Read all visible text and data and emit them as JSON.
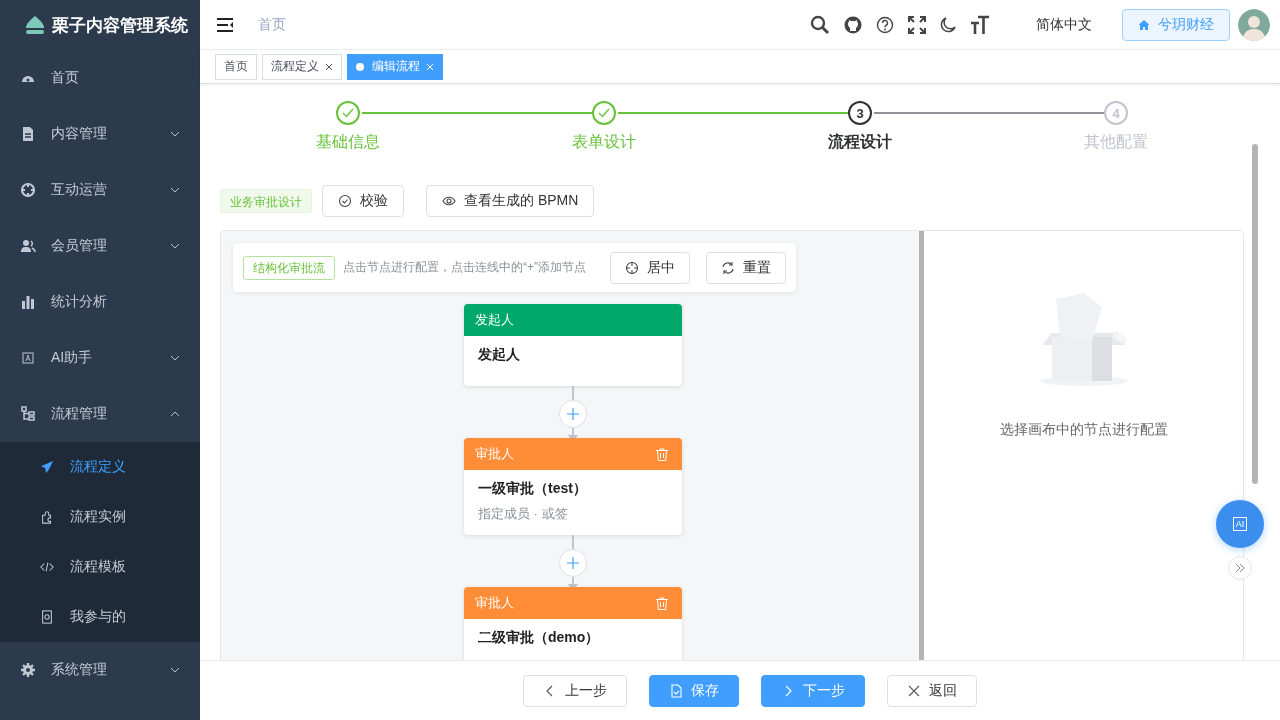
{
  "app": {
    "title": "栗子内容管理系统"
  },
  "sidebar": {
    "items": [
      {
        "label": "首页",
        "selected": false
      },
      {
        "label": "内容管理",
        "selected": false,
        "expanded": false
      },
      {
        "label": "互动运营",
        "selected": false,
        "expanded": false
      },
      {
        "label": "会员管理",
        "selected": false,
        "expanded": false
      },
      {
        "label": "统计分析",
        "selected": false
      },
      {
        "label": "AI助手",
        "selected": false,
        "expanded": false
      },
      {
        "label": "流程管理",
        "selected": false,
        "expanded": true,
        "children": [
          {
            "label": "流程定义",
            "selected": true
          },
          {
            "label": "流程实例",
            "selected": false
          },
          {
            "label": "流程模板",
            "selected": false
          },
          {
            "label": "我参与的",
            "selected": false
          }
        ]
      },
      {
        "label": "系统管理",
        "selected": false,
        "expanded": false
      }
    ]
  },
  "header": {
    "breadcrumb": [
      "首页"
    ],
    "language": "简体中文",
    "workspace_button": "兮玥财经"
  },
  "tabs": [
    {
      "label": "首页",
      "selected": false,
      "closable": false
    },
    {
      "label": "流程定义",
      "selected": false,
      "closable": true
    },
    {
      "label": "编辑流程",
      "selected": true,
      "closable": true
    }
  ],
  "steps": [
    {
      "label": "基础信息",
      "done": true
    },
    {
      "label": "表单设计",
      "done": true
    },
    {
      "label": "流程设计",
      "number": "3",
      "done": false,
      "active": true
    },
    {
      "label": "其他配置",
      "number": "4",
      "done": false,
      "active": false
    }
  ],
  "toolbar": {
    "tag": "业务审批设计",
    "buttons": [
      {
        "label": "校验"
      },
      {
        "label": "查看生成的 BPMN"
      }
    ]
  },
  "designer": {
    "tag": "结构化审批流",
    "hint": "点击节点进行配置，点击连线中的“+”添加节点",
    "buttons": [
      {
        "label": "居中"
      },
      {
        "label": "重置"
      }
    ],
    "nodes": [
      {
        "kind": "start",
        "header": "发起人",
        "title": "发起人"
      },
      {
        "kind": "approver",
        "header": "审批人",
        "title": "一级审批（test）",
        "subtitle": "指定成员 · 或签"
      },
      {
        "kind": "approver",
        "header": "审批人",
        "title": "二级审批（demo）"
      }
    ]
  },
  "config_panel": {
    "empty_text": "选择画布中的节点进行配置"
  },
  "fab": {
    "label": "AI"
  },
  "footer_buttons": [
    {
      "label": "上一步",
      "kind": "default"
    },
    {
      "label": "保存",
      "kind": "primary"
    },
    {
      "label": "下一步",
      "kind": "primary"
    },
    {
      "label": "返回",
      "kind": "default"
    }
  ]
}
